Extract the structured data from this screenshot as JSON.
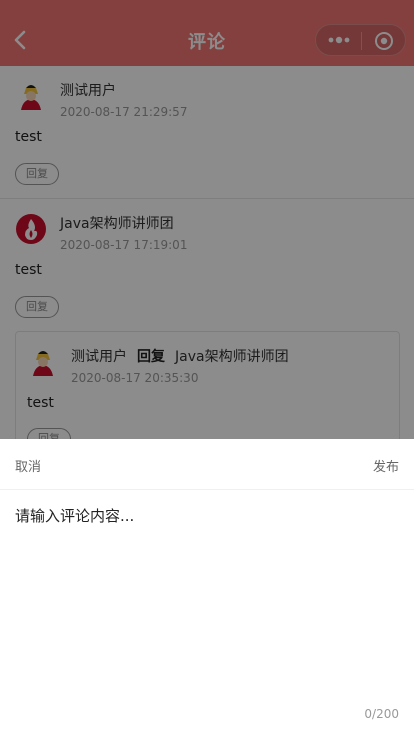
{
  "header": {
    "title": "评论"
  },
  "comments": [
    {
      "user": "测试用户",
      "time": "2020-08-17 21:29:57",
      "text": "test",
      "reply_label": "回复"
    },
    {
      "user": "Java架构师讲师团",
      "time": "2020-08-17 17:19:01",
      "text": "test",
      "reply_label": "回复",
      "reply": {
        "user": "测试用户",
        "reply_word": "回复",
        "target": "Java架构师讲师团",
        "time": "2020-08-17 20:35:30",
        "text": "test",
        "reply_label": "回复"
      }
    }
  ],
  "panel": {
    "cancel": "取消",
    "publish": "发布",
    "placeholder": "请输入评论内容...",
    "counter": "0/200"
  },
  "colors": {
    "header_bg": "#f07573",
    "overlay": "rgba(0,0,0,0.45)",
    "avatar_red": "#c8102e"
  }
}
